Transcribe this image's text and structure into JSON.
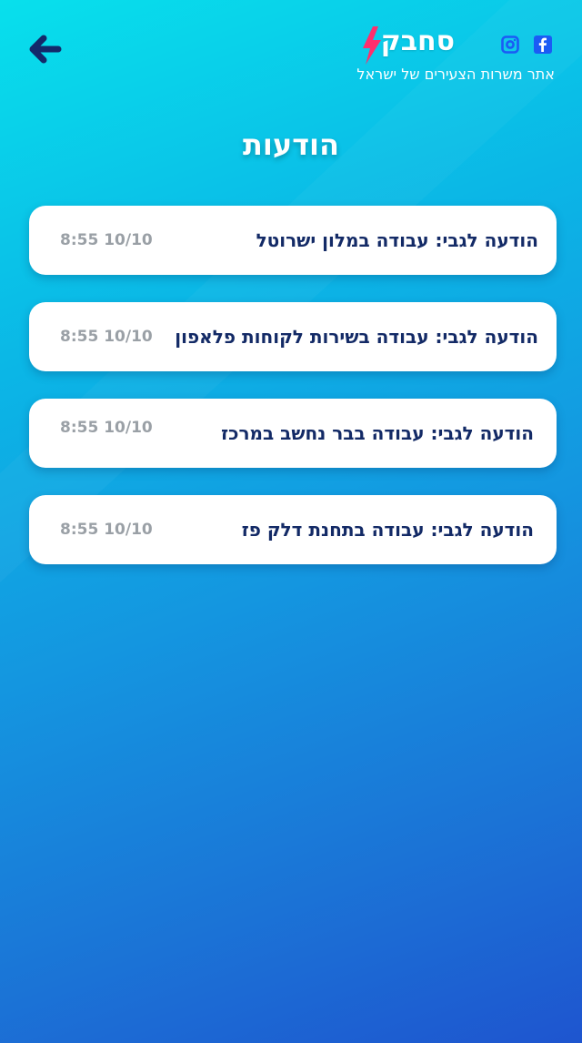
{
  "header": {
    "logo_text": "סחבק",
    "tagline": "אתר משרות הצעירים של ישראל",
    "back_icon": "arrow-left-icon",
    "social": [
      "instagram-icon",
      "facebook-icon"
    ]
  },
  "page": {
    "title": "הודעות"
  },
  "messages": [
    {
      "title": "הודעה לגבי: עבודה במלון ישרוטל",
      "time": "8:55 10/10"
    },
    {
      "title": "הודעה לגבי: עבודה בשירות לקוחות פלאפון",
      "time": "8:55 10/10"
    },
    {
      "title": "הודעה לגבי: עבודה בבר נחשב במרכז",
      "time": "8:55 10/10"
    },
    {
      "title": "הודעה לגבי: עבודה בתחנת דלק פז",
      "time": "8:55 10/10"
    }
  ],
  "colors": {
    "accent_navy": "#132a66",
    "bolt_pink": "#ff2f6d",
    "facebook_blue": "#1b5bf5",
    "time_gray": "#9aa0a6"
  }
}
